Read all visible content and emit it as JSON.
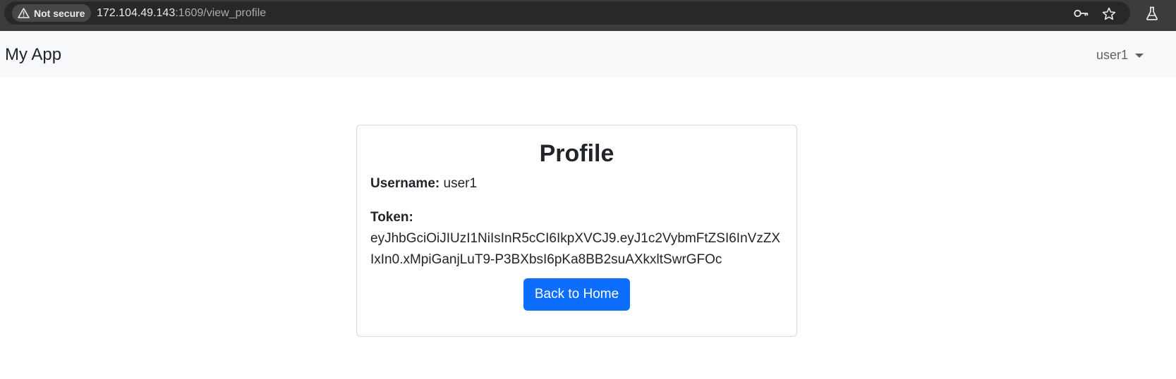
{
  "browser": {
    "security_label": "Not secure",
    "url_host": "172.104.49.143",
    "url_path": ":1609/view_profile",
    "icons": [
      "warning-icon",
      "key-icon",
      "star-icon",
      "flask-icon"
    ]
  },
  "navbar": {
    "brand": "My App",
    "user_label": "user1"
  },
  "profile": {
    "title": "Profile",
    "username_label": "Username:",
    "username_value": "user1",
    "token_label": "Token:",
    "token_value": "eyJhbGciOiJIUzI1NiIsInR5cCI6IkpXVCJ9.eyJ1c2VybmFtZSI6InVzZXIxIn0.xMpiGanjLuT9-P3BXbsI6pKa8BB2suAXkxltSwrGFOc",
    "back_button": "Back to Home"
  },
  "colors": {
    "primary": "#0d6efd",
    "navbar_bg": "#f8f9fa",
    "browser_bg": "#3c3c3c"
  }
}
